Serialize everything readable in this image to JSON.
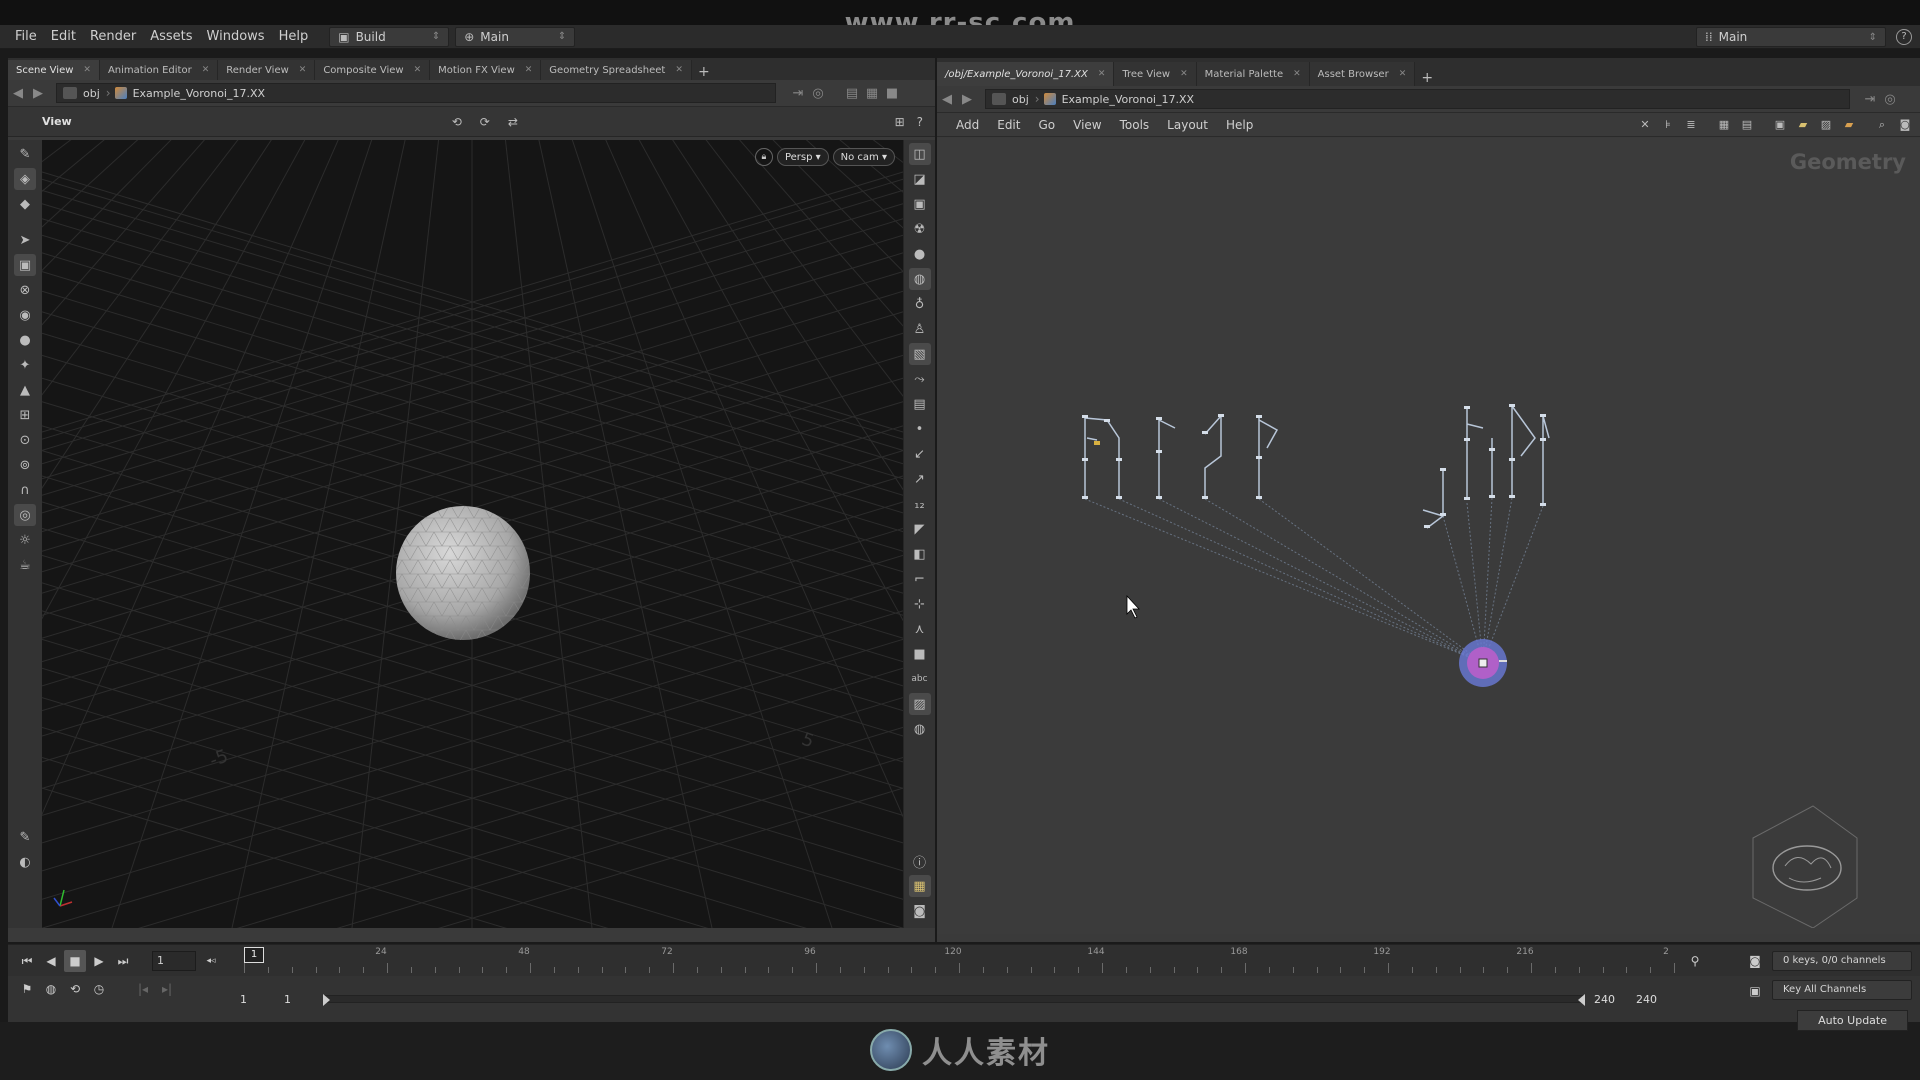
{
  "watermark": {
    "site": "www.rr-sc.com",
    "brand": "人人素材"
  },
  "menubar": {
    "items": [
      "File",
      "Edit",
      "Render",
      "Assets",
      "Windows",
      "Help"
    ],
    "desktop_left": "Build",
    "desktop_main": "Main",
    "desktop_right": "Main"
  },
  "left_pane": {
    "tabs": [
      "Scene View",
      "Animation Editor",
      "Render View",
      "Composite View",
      "Motion FX View",
      "Geometry Spreadsheet"
    ],
    "path": {
      "root": "obj",
      "node": "Example_Voronoi_17.XX"
    },
    "view_title": "View",
    "viewport": {
      "camera_mode": "Persp",
      "camera": "No cam",
      "axis_labels": [
        "-5",
        "5"
      ]
    }
  },
  "right_pane": {
    "tabs": [
      "/obj/Example_Voronoi_17.XX",
      "Tree View",
      "Material Palette",
      "Asset Browser"
    ],
    "path": {
      "root": "obj",
      "node": "Example_Voronoi_17.XX"
    },
    "menu": [
      "Add",
      "Edit",
      "Go",
      "View",
      "Tools",
      "Layout",
      "Help"
    ],
    "context_label": "Geometry"
  },
  "timeline": {
    "current_frame": "1",
    "frame_marker": "1",
    "ticks": [
      "24",
      "48",
      "72",
      "96",
      "120",
      "144",
      "168",
      "192",
      "216",
      "2"
    ],
    "range_start": "1",
    "range_start2": "1",
    "range_end": "240",
    "range_end2": "240",
    "keys_info": "0 keys, 0/0 channels",
    "key_all": "Key All Channels",
    "auto_update": "Auto Update"
  }
}
